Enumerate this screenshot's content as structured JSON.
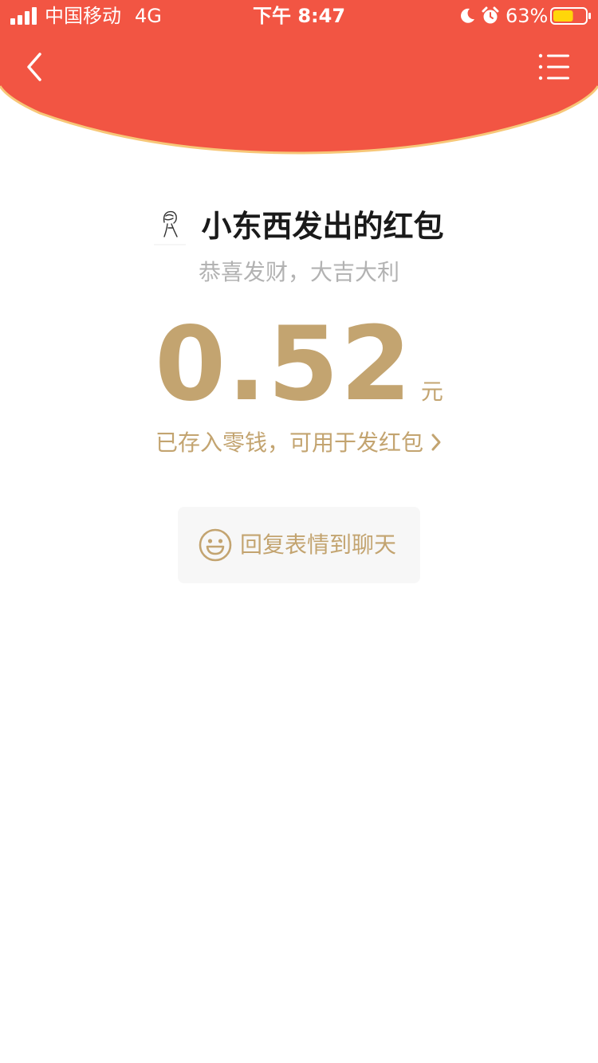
{
  "status_bar": {
    "carrier": "中国移动",
    "network": "4G",
    "time": "下午 8:47",
    "battery_percent": "63%",
    "battery_level": 0.63,
    "icons": [
      "signal-icon",
      "moon-icon",
      "alarm-icon",
      "battery-icon"
    ]
  },
  "nav": {
    "back_icon": "chevron-left-icon",
    "menu_icon": "list-menu-icon"
  },
  "packet": {
    "sender_title": "小东西发出的红包",
    "greeting": "恭喜发财，大吉大利",
    "amount": "0.52",
    "currency_unit": "元",
    "stored_text": "已存入零钱，可用于发红包"
  },
  "reply": {
    "icon": "smile-icon",
    "label": "回复表情到聊天"
  },
  "colors": {
    "header_red": "#f25543",
    "header_border": "#f7c778",
    "gold": "#c3a470",
    "muted_gray": "#b2b2b2",
    "title_dark": "#1a1a1a",
    "button_bg": "#f7f7f7",
    "battery_yellow": "#ffd60a"
  }
}
